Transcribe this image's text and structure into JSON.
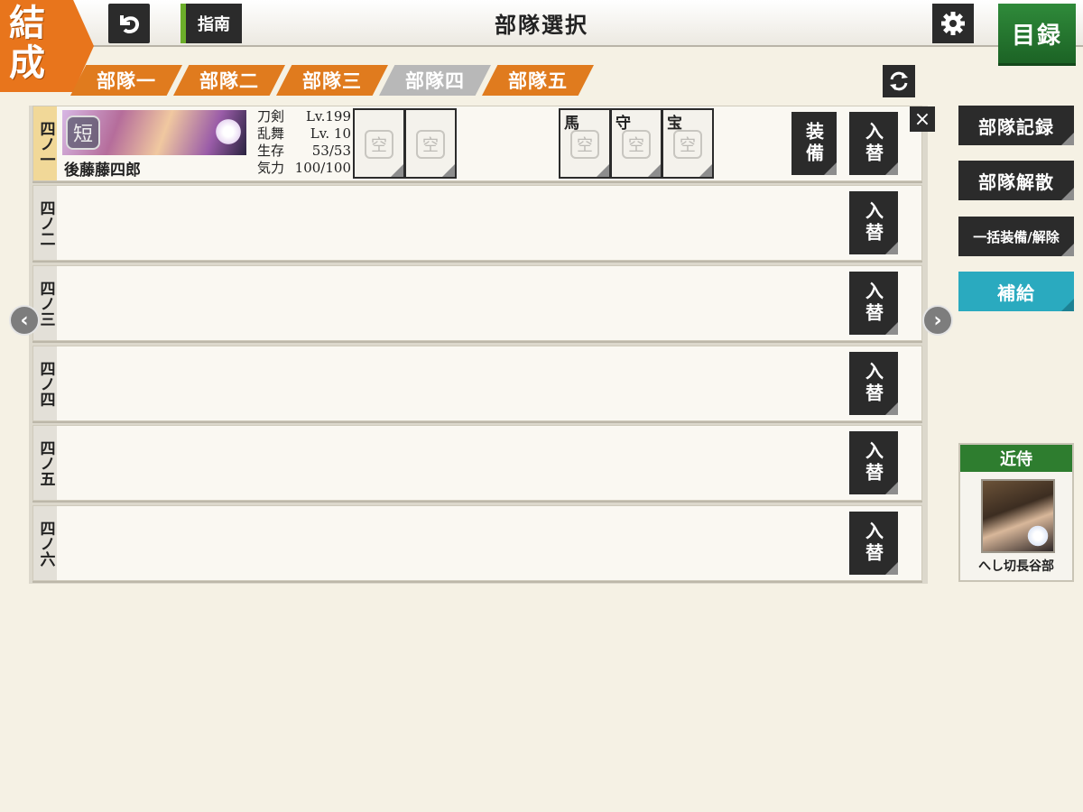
{
  "header": {
    "logo_line1": "結",
    "logo_line2": "成",
    "guide_label": "指南",
    "title": "部隊選択",
    "catalog_label": "目録"
  },
  "tabs": [
    {
      "label": "部隊一",
      "active": false
    },
    {
      "label": "部隊二",
      "active": false
    },
    {
      "label": "部隊三",
      "active": false
    },
    {
      "label": "部隊四",
      "active": true
    },
    {
      "label": "部隊五",
      "active": false
    }
  ],
  "rows": [
    {
      "label": "四ノ一",
      "swap_label": "入替"
    },
    {
      "label": "四ノ二",
      "swap_label": "入替"
    },
    {
      "label": "四ノ三",
      "swap_label": "入替"
    },
    {
      "label": "四ノ四",
      "swap_label": "入替"
    },
    {
      "label": "四ノ五",
      "swap_label": "入替"
    },
    {
      "label": "四ノ六",
      "swap_label": "入替"
    }
  ],
  "member": {
    "type_badge": "短",
    "name": "後藤藤四郎",
    "stats": [
      {
        "label": "刀剣",
        "value": "Lv.199"
      },
      {
        "label": "乱舞",
        "value": "Lv. 10"
      },
      {
        "label": "生存",
        "value": "53/53"
      },
      {
        "label": "気力",
        "value": "100/100"
      }
    ],
    "slots": [
      "空",
      "空"
    ],
    "extra_slots": [
      {
        "title": "馬",
        "value": "空"
      },
      {
        "title": "守",
        "value": "空"
      },
      {
        "title": "宝",
        "value": "空"
      }
    ],
    "equip_label": "装備"
  },
  "close_label": "×",
  "side_buttons": {
    "record": "部隊記録",
    "disband": "部隊解散",
    "bulk_equip": "一括装備/解除",
    "supply": "補給"
  },
  "attendant": {
    "title": "近侍",
    "name": "へし切長谷部"
  },
  "colors": {
    "accent_orange": "#e07b1e",
    "catalog_green": "#1c6325",
    "supply_cyan": "#2aaabf",
    "inactive_tab": "#b8b8b8"
  }
}
